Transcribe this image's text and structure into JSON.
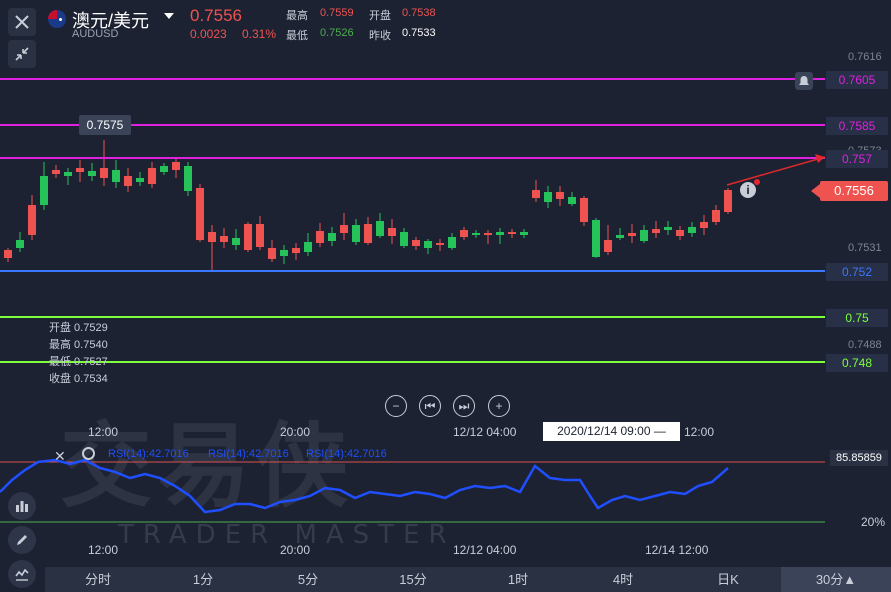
{
  "header": {
    "title": "澳元/美元",
    "symbol": "AUDUSD",
    "price": "0.7556",
    "change": "0.0023",
    "change_pct": "0.31%",
    "high_label": "最高",
    "high": "0.7559",
    "open_label": "开盘",
    "open": "0.7538",
    "low_label": "最低",
    "low": "0.7526",
    "prev_close_label": "昨收",
    "prev_close": "0.7533"
  },
  "y_ticks": [
    "0.7616",
    "0.7573",
    "0.7531",
    "0.7488"
  ],
  "hlines": [
    {
      "label": "0.7605",
      "color": "#e020e0"
    },
    {
      "label": "0.7585",
      "color": "#e020e0"
    },
    {
      "label": "0.757",
      "color": "#e020e0"
    },
    {
      "label": "0.752",
      "color": "#3a78ff"
    },
    {
      "label": "0.75",
      "color": "#7cff3a"
    },
    {
      "label": "0.748",
      "color": "#7cff3a"
    }
  ],
  "price_tag": "0.7556",
  "crosshair_tag": "0.7575",
  "ohlc_panel": {
    "open": "开盘 0.7529",
    "high": "最高 0.7540",
    "low": "最低 0.7527",
    "close": "收盘 0.7534"
  },
  "x_labels": [
    "12:00",
    "20:00",
    "12/12 04:00",
    "12:00"
  ],
  "crosshair_time": "2020/12/14 09:00 —",
  "rsi": {
    "label1": "RSI(14):42.7016",
    "label2": "RSI(14):42.7016",
    "label3": "RSI(14):42.7016",
    "value_tag": "85.85859",
    "level_low": "20%"
  },
  "bottom_x_labels": [
    "12:00",
    "20:00",
    "12/12 04:00",
    "12/14 12:00"
  ],
  "timeframes": [
    "分时",
    "1分",
    "5分",
    "15分",
    "1时",
    "4时",
    "日K",
    "30分▲"
  ],
  "active_timeframe": "30分▲",
  "watermark": {
    "cn": "交易侠",
    "en": "TRADER MASTER"
  },
  "colors": {
    "up": "#ef5350",
    "down": "#26c35a",
    "rsi": "#1f4fff"
  }
}
